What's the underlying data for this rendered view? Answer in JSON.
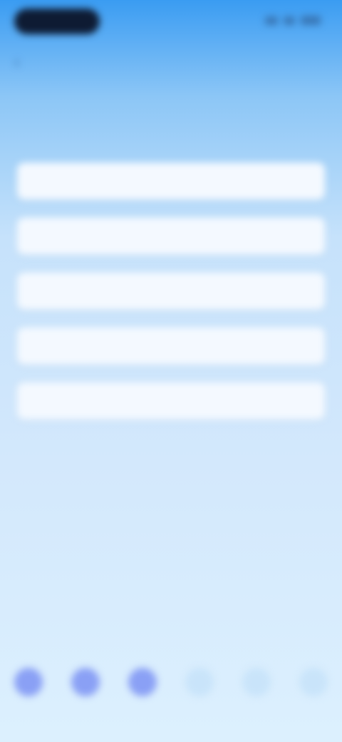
{
  "status_bar": {
    "time": "",
    "icons": [
      "signal-icon",
      "wifi-icon",
      "battery-icon"
    ]
  },
  "header": {
    "back_label": ""
  },
  "step_caption": "",
  "question": "",
  "options": [
    {
      "label": ""
    },
    {
      "label": ""
    },
    {
      "label": ""
    },
    {
      "label": ""
    },
    {
      "label": ""
    }
  ],
  "bottom_nav": [
    {
      "icon": "nav-icon",
      "label": ""
    },
    {
      "icon": "nav-icon",
      "label": ""
    },
    {
      "icon": "nav-icon",
      "label": ""
    },
    {
      "icon": "nav-icon",
      "label": ""
    },
    {
      "icon": "nav-icon",
      "label": ""
    },
    {
      "icon": "nav-icon",
      "label": ""
    }
  ],
  "colors": {
    "header_blue": "#3a9cf2",
    "background_light": "#d3e8fc",
    "option_bg": "#f4f9ff",
    "nav_accent": "#8aa0f5",
    "status_pill": "#0e1b33"
  }
}
